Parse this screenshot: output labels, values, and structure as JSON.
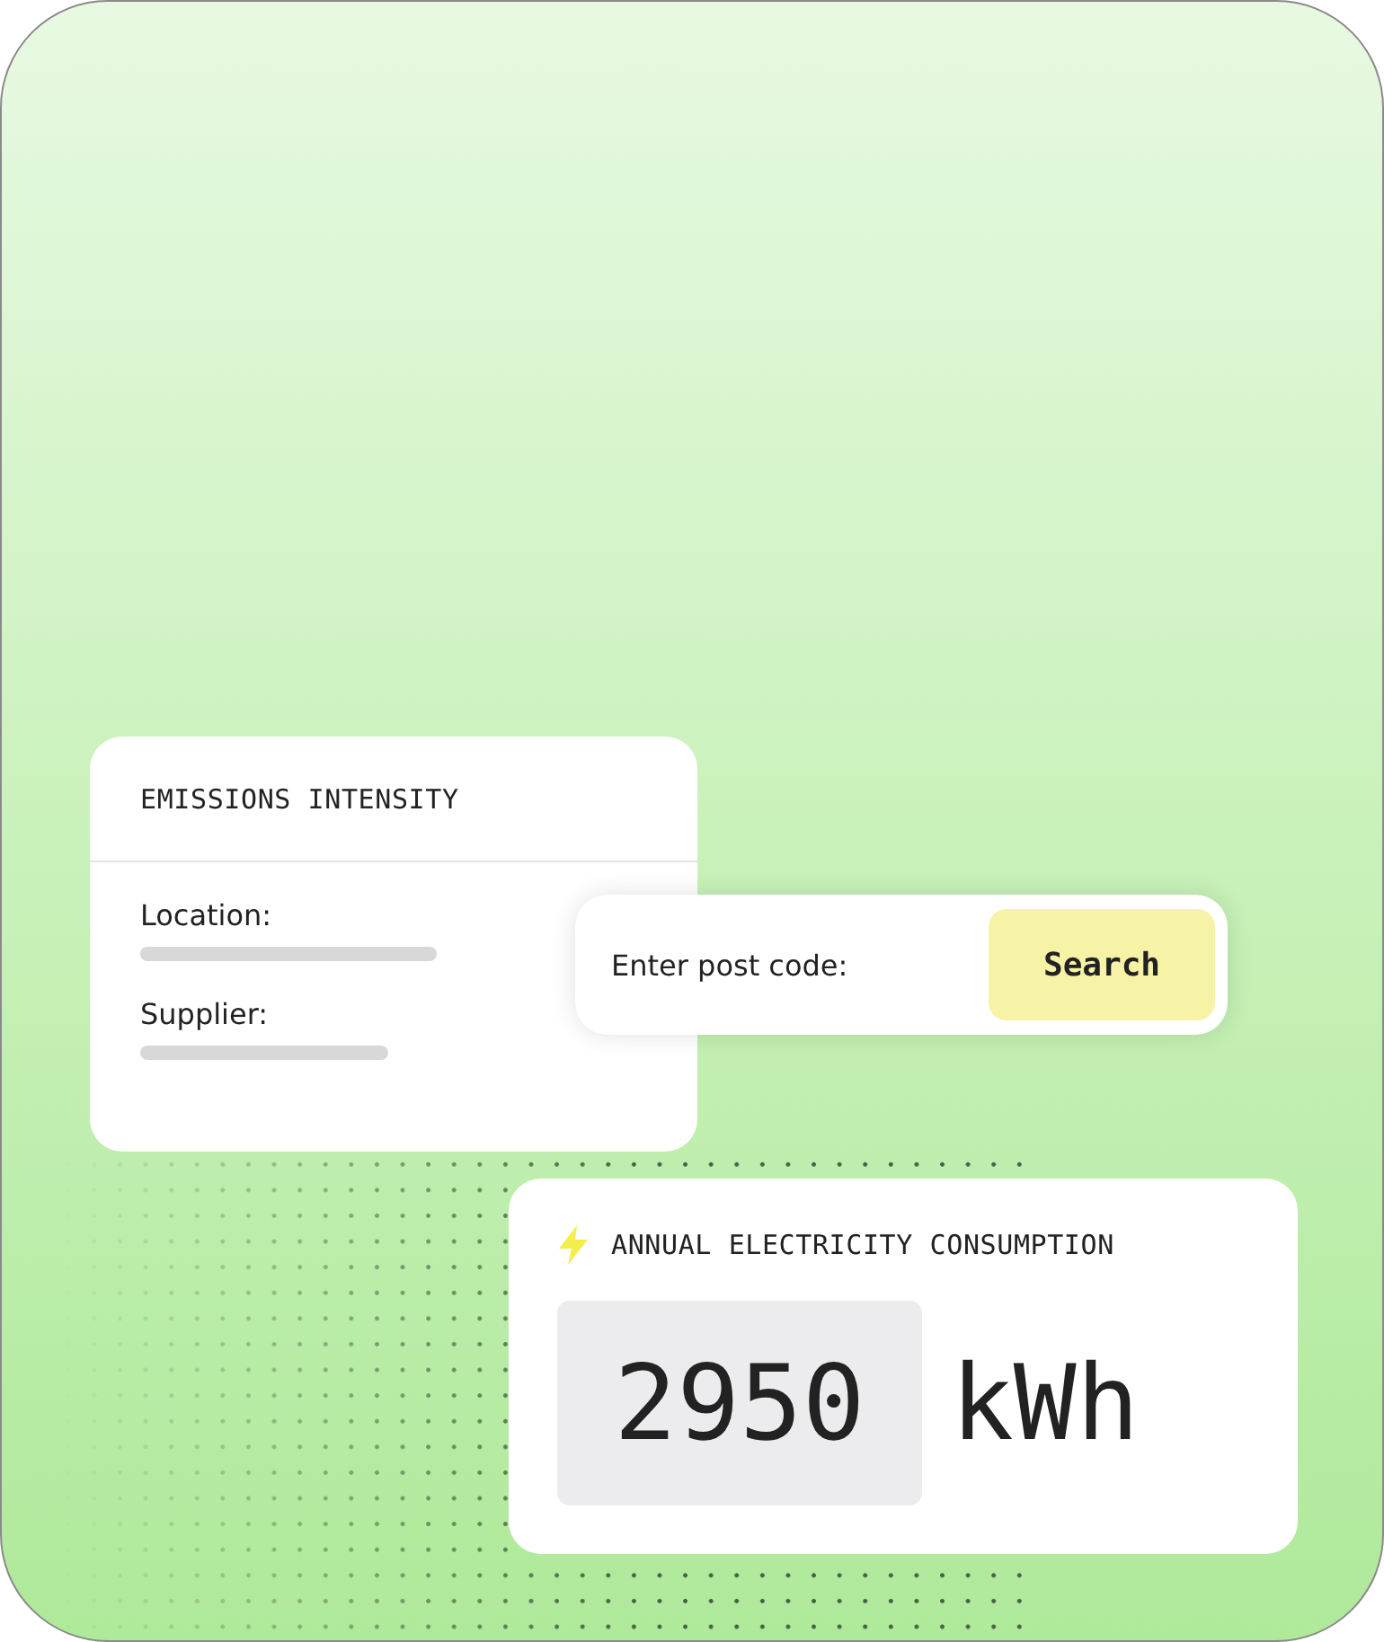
{
  "emissions_card": {
    "title": "EMISSIONS INTENSITY",
    "fields": [
      {
        "label": "Location:"
      },
      {
        "label": "Supplier:"
      }
    ]
  },
  "postcode_search": {
    "placeholder": "Enter post code:",
    "button": "Search"
  },
  "consumption_card": {
    "title": "ANNUAL ELECTRICITY CONSUMPTION",
    "value": "2950",
    "unit": "kWh"
  }
}
